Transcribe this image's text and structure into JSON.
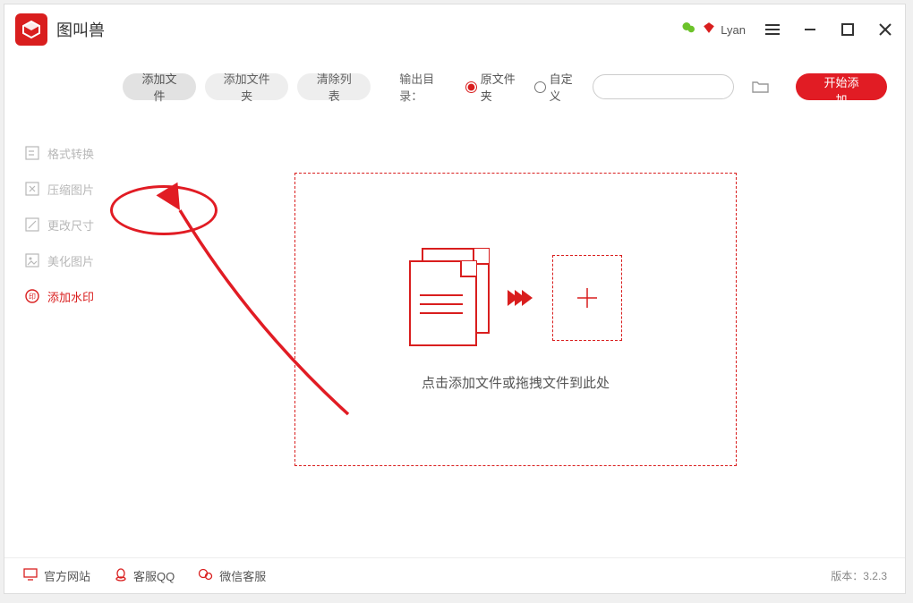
{
  "app": {
    "title": "图叫兽"
  },
  "user": {
    "name": "Lyan"
  },
  "toolbar": {
    "add_file": "添加文件",
    "add_folder": "添加文件夹",
    "clear_list": "清除列表",
    "output_label": "输出目录：",
    "radio_original": "原文件夹",
    "radio_custom": "自定义",
    "start": "开始添加"
  },
  "sidebar": {
    "items": [
      {
        "label": "格式转换"
      },
      {
        "label": "压缩图片"
      },
      {
        "label": "更改尺寸"
      },
      {
        "label": "美化图片"
      },
      {
        "label": "添加水印"
      }
    ],
    "active_index": 4
  },
  "dropzone": {
    "hint": "点击添加文件或拖拽文件到此处"
  },
  "footer": {
    "website": "官方网站",
    "qq": "客服QQ",
    "wechat": "微信客服",
    "version": "版本：3.2.3"
  }
}
